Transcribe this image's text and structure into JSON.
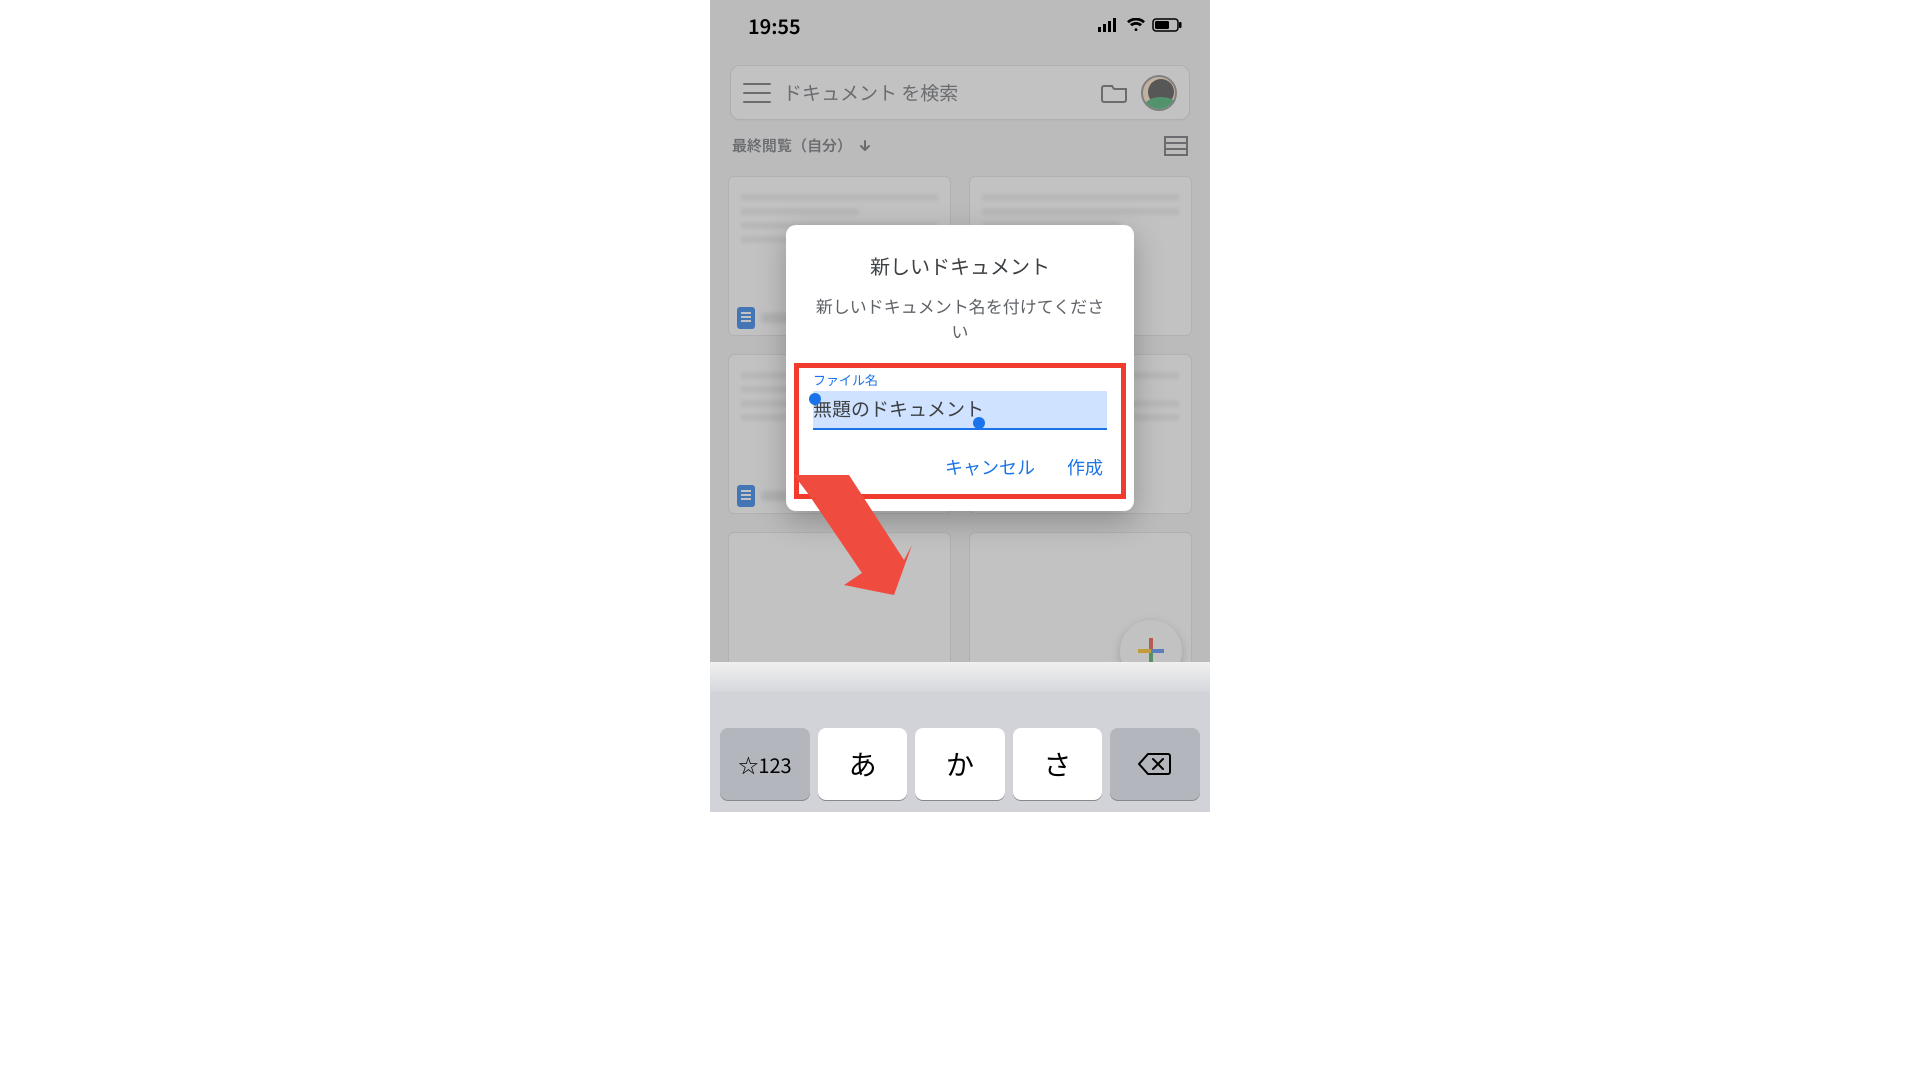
{
  "status": {
    "time": "19:55"
  },
  "search": {
    "placeholder": "ドキュメント を検索"
  },
  "filter": {
    "sort_label": "最終閲覧（自分）"
  },
  "dialog": {
    "title": "新しいドキュメント",
    "subtitle": "新しいドキュメント名を付けてください",
    "field_label": "ファイル名",
    "field_value": "無題のドキュメント",
    "cancel": "キャンセル",
    "create": "作成"
  },
  "keyboard": {
    "switch": "☆123",
    "k1": "あ",
    "k2": "か",
    "k3": "さ"
  }
}
